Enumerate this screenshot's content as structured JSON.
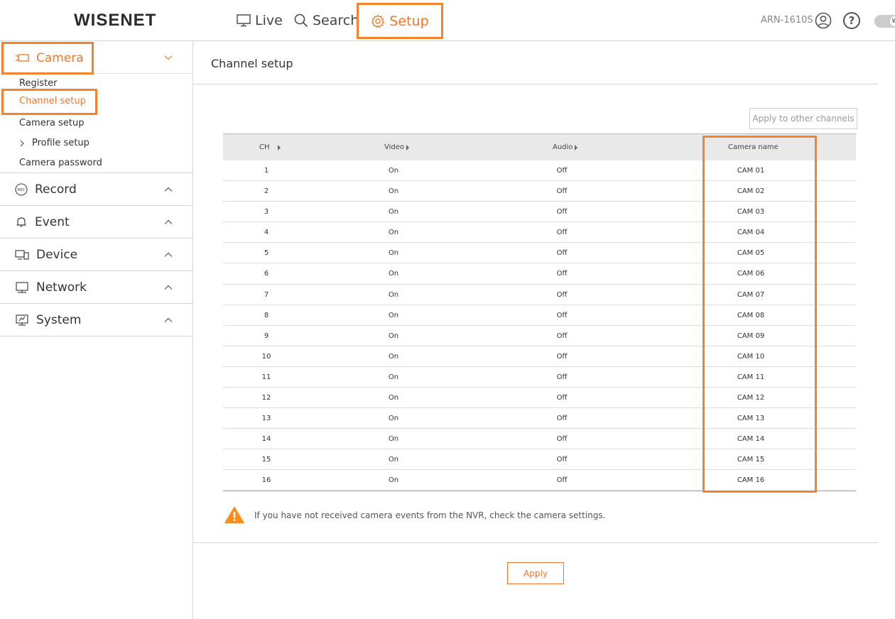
{
  "header": {
    "logo": "WISENET",
    "nav": {
      "live": "Live",
      "search": "Search",
      "setup": "Setup"
    },
    "model": "ARN-1610S",
    "help": "?",
    "toggle": "W"
  },
  "sidebar": {
    "camera": {
      "label": "Camera",
      "sub": {
        "register": "Register",
        "channel_setup": "Channel setup",
        "camera_setup": "Camera setup",
        "profile_setup": "Profile setup",
        "camera_password": "Camera password"
      }
    },
    "menu": {
      "record": "Record",
      "event": "Event",
      "device": "Device",
      "network": "Network",
      "system": "System"
    },
    "rec_badge": "REC"
  },
  "main": {
    "title": "Channel setup",
    "apply_other": "Apply to other channels",
    "columns": {
      "ch": "CH",
      "video": "Video",
      "audio": "Audio",
      "name": "Camera name"
    },
    "rows": [
      {
        "ch": "1",
        "video": "On",
        "audio": "Off",
        "name": "CAM 01"
      },
      {
        "ch": "2",
        "video": "On",
        "audio": "Off",
        "name": "CAM 02"
      },
      {
        "ch": "3",
        "video": "On",
        "audio": "Off",
        "name": "CAM 03"
      },
      {
        "ch": "4",
        "video": "On",
        "audio": "Off",
        "name": "CAM 04"
      },
      {
        "ch": "5",
        "video": "On",
        "audio": "Off",
        "name": "CAM 05"
      },
      {
        "ch": "6",
        "video": "On",
        "audio": "Off",
        "name": "CAM 06"
      },
      {
        "ch": "7",
        "video": "On",
        "audio": "Off",
        "name": "CAM 07"
      },
      {
        "ch": "8",
        "video": "On",
        "audio": "Off",
        "name": "CAM 08"
      },
      {
        "ch": "9",
        "video": "On",
        "audio": "Off",
        "name": "CAM 09"
      },
      {
        "ch": "10",
        "video": "On",
        "audio": "Off",
        "name": "CAM 10"
      },
      {
        "ch": "11",
        "video": "On",
        "audio": "Off",
        "name": "CAM 11"
      },
      {
        "ch": "12",
        "video": "On",
        "audio": "Off",
        "name": "CAM 12"
      },
      {
        "ch": "13",
        "video": "On",
        "audio": "Off",
        "name": "CAM 13"
      },
      {
        "ch": "14",
        "video": "On",
        "audio": "Off",
        "name": "CAM 14"
      },
      {
        "ch": "15",
        "video": "On",
        "audio": "Off",
        "name": "CAM 15"
      },
      {
        "ch": "16",
        "video": "On",
        "audio": "Off",
        "name": "CAM 16"
      }
    ],
    "warning": "If you have not received camera events from the NVR, check the camera settings.",
    "apply": "Apply"
  },
  "colors": {
    "accent": "#f0772b",
    "highlight_border": "#f5832b",
    "warning": "#f5901e"
  }
}
